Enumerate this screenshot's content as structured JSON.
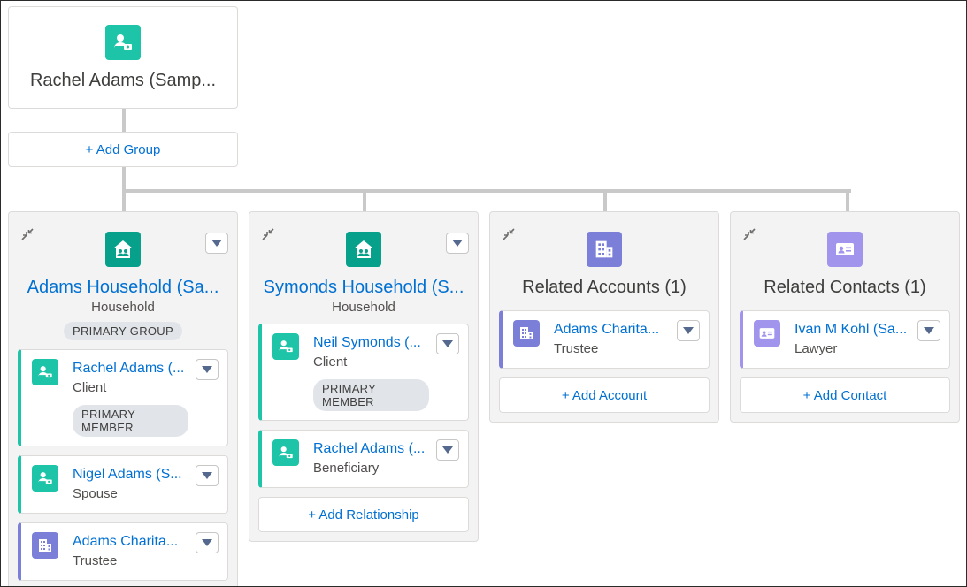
{
  "root": {
    "name": "Rachel Adams (Samp...",
    "add_group_label": "+ Add Group"
  },
  "groups": [
    {
      "title": "Adams Household (Sa...",
      "subtitle": "Household",
      "badge": "PRIMARY GROUP",
      "members": [
        {
          "name": "Rachel Adams (...",
          "role": "Client",
          "badge": "PRIMARY MEMBER",
          "icon": "person-money-icon"
        },
        {
          "name": "Nigel Adams (S...",
          "role": "Spouse",
          "icon": "person-money-icon"
        },
        {
          "name": "Adams Charita...",
          "role": "Trustee",
          "icon": "building-icon"
        }
      ]
    },
    {
      "title": "Symonds Household (S...",
      "subtitle": "Household",
      "members": [
        {
          "name": "Neil Symonds (...",
          "role": "Client",
          "badge": "PRIMARY MEMBER",
          "icon": "person-money-icon"
        },
        {
          "name": "Rachel Adams (...",
          "role": "Beneficiary",
          "icon": "person-money-icon"
        }
      ],
      "add_label": "+ Add Relationship"
    },
    {
      "title": "Related Accounts (1)",
      "members": [
        {
          "name": "Adams Charita...",
          "role": "Trustee",
          "icon": "building-icon"
        }
      ],
      "add_label": "+ Add Account"
    },
    {
      "title": "Related Contacts (1)",
      "members": [
        {
          "name": "Ivan M Kohl (Sa...",
          "role": "Lawyer",
          "icon": "contact-card-icon"
        }
      ],
      "add_label": "+ Add Contact"
    }
  ],
  "colors": {
    "link": "#0070d2",
    "person_icon": "#1ec4a8",
    "household_icon": "#07a08b",
    "account_icon": "#7b7fd8",
    "contact_icon": "#a094ed",
    "connector": "#c9c9c9"
  }
}
